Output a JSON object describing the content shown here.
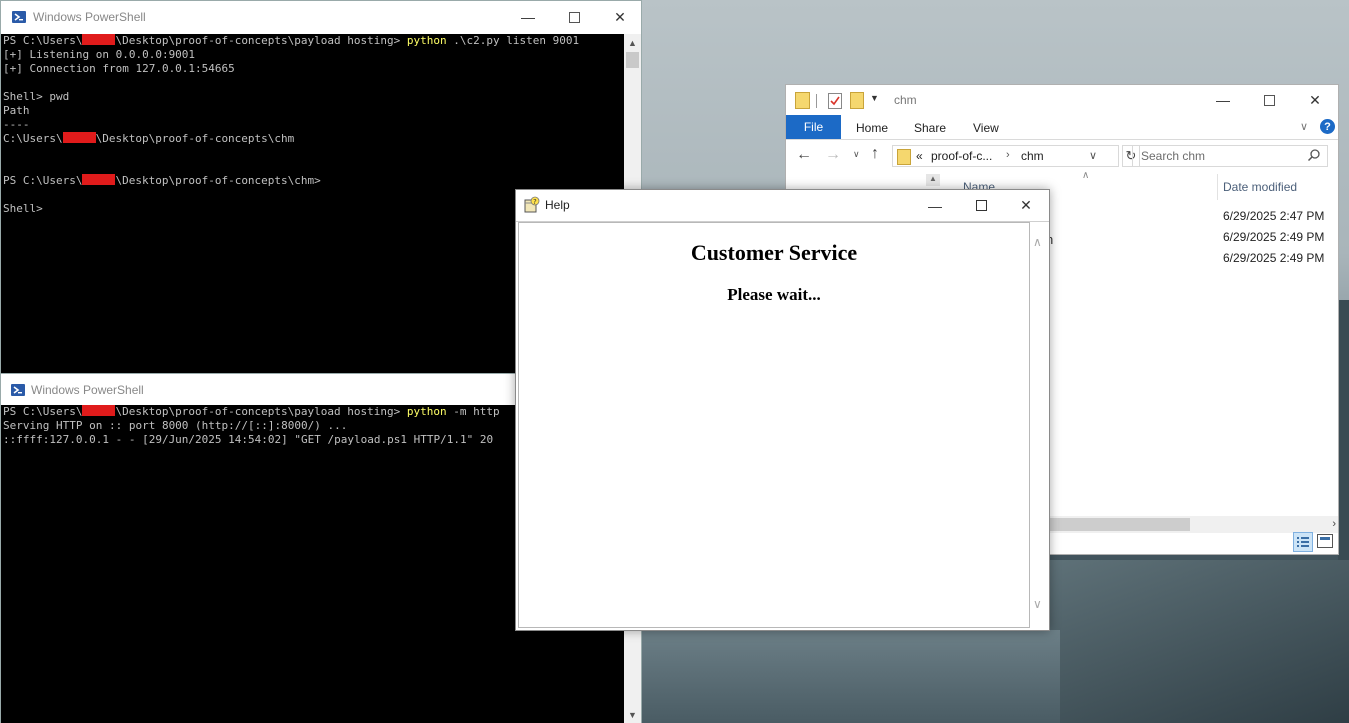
{
  "colors": {
    "console_bg": "#000000",
    "console_text": "#c0c0c0",
    "command_highlight": "#ffff66",
    "redaction": "#e01b1b",
    "file_tab": "#1c6ac6",
    "help_bg": "#ffffff"
  },
  "ps_top": {
    "title": "Windows PowerShell",
    "lines": [
      {
        "prefix": "PS C:\\Users\\",
        "redacted": true,
        "suffix": "\\Desktop\\proof-of-concepts\\payload hosting> ",
        "cmd": "python",
        "args": " .\\c2.py listen 9001"
      },
      {
        "text": "[+] Listening on 0.0.0.0:9001"
      },
      {
        "text": "[+] Connection from 127.0.0.1:54665"
      },
      {
        "text": ""
      },
      {
        "text": "Shell> pwd"
      },
      {
        "text": "Path"
      },
      {
        "text": "----"
      },
      {
        "prefix": "C:\\Users\\",
        "redacted": true,
        "suffix": "\\Desktop\\proof-of-concepts\\chm"
      },
      {
        "text": ""
      },
      {
        "text": ""
      },
      {
        "prefix": "PS C:\\Users\\",
        "redacted": true,
        "suffix": "\\Desktop\\proof-of-concepts\\chm>"
      },
      {
        "text": ""
      },
      {
        "text": "Shell>"
      }
    ]
  },
  "ps_bottom": {
    "title": "Windows PowerShell",
    "lines": [
      {
        "prefix": "PS C:\\Users\\",
        "redacted": true,
        "suffix": "\\Desktop\\proof-of-concepts\\payload hosting> ",
        "cmd": "python",
        "args": " -m http"
      },
      {
        "text": "Serving HTTP on :: port 8000 (http://[::]:8000/) ..."
      },
      {
        "text": "::ffff:127.0.0.1 - - [29/Jun/2025 14:54:02] \"GET /payload.ps1 HTTP/1.1\" 20"
      }
    ]
  },
  "explorer": {
    "title": "chm",
    "tabs": [
      "File",
      "Home",
      "Share",
      "View"
    ],
    "address": {
      "chevrons": "«",
      "parts": [
        "proof-of-c...",
        "chm"
      ]
    },
    "search_placeholder": "Search chm",
    "columns": {
      "name": "Name",
      "date": "Date modified"
    },
    "dates": [
      "6/29/2025 2:47 PM",
      "6/29/2025 2:49 PM",
      "6/29/2025 2:49 PM"
    ]
  },
  "help": {
    "title": "Help",
    "heading": "Customer Service",
    "message": "Please wait..."
  }
}
